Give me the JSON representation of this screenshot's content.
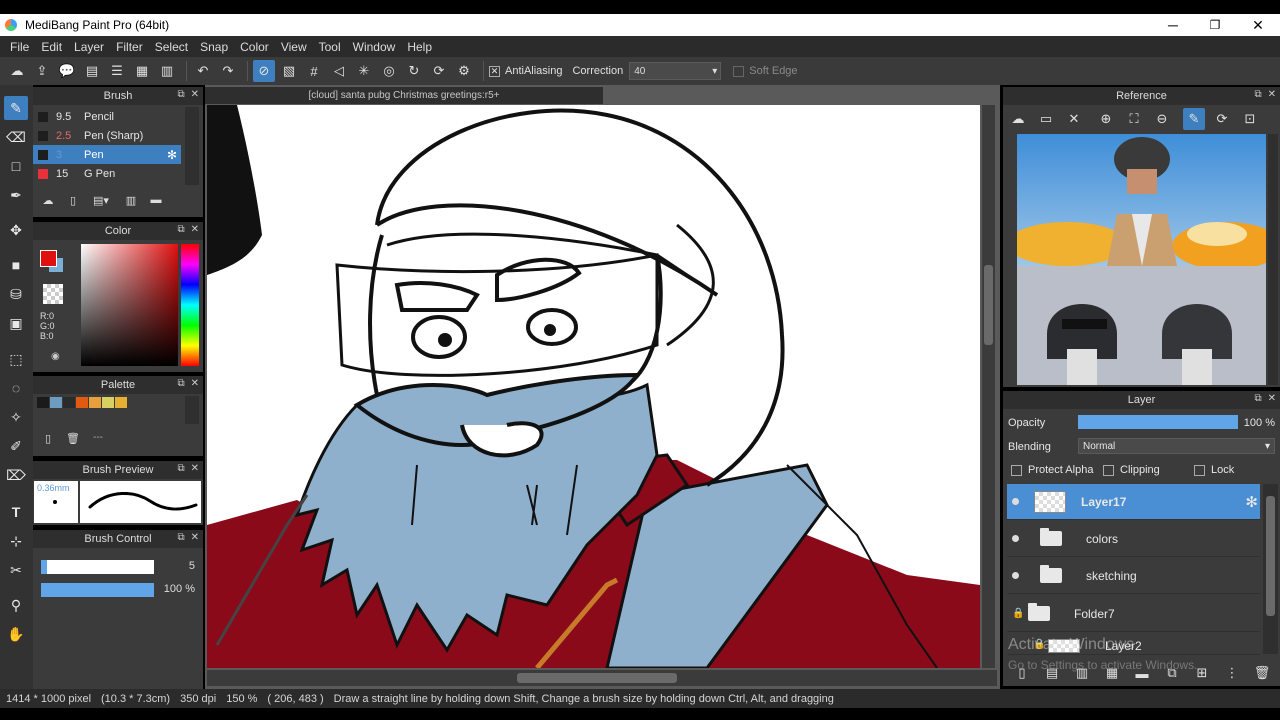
{
  "window": {
    "title": "MediBang Paint Pro (64bit)",
    "minimize": "─",
    "restore": "❐",
    "close": "✕"
  },
  "menu": [
    "File",
    "Edit",
    "Layer",
    "Filter",
    "Select",
    "Snap",
    "Color",
    "View",
    "Tool",
    "Window",
    "Help"
  ],
  "toolbar": {
    "antialiasing_label": "AntiAliasing",
    "antialiasing_checked": "✕",
    "correction_label": "Correction",
    "correction_value": "40",
    "soft_edge_label": "Soft Edge"
  },
  "document": {
    "tab_title": "[cloud] santa pubg Christmas greetings:r5+"
  },
  "brush_panel": {
    "title": "Brush",
    "items": [
      {
        "size": "9.5",
        "name": "Pencil",
        "color": "#1e1e1e"
      },
      {
        "size": "2.5",
        "name": "Pen (Sharp)",
        "color": "#1e1e1e"
      },
      {
        "size": "3",
        "name": "Pen",
        "color": "#1e1e1e"
      },
      {
        "size": "15",
        "name": "G Pen",
        "color": "#e8303a"
      }
    ]
  },
  "color_panel": {
    "title": "Color",
    "r": "R:0",
    "g": "G:0",
    "b": "B:0",
    "primary": "#e01010",
    "secondary": "#7ab0d8"
  },
  "palette_panel": {
    "title": "Palette",
    "swatches": [
      "#1a1a1a",
      "#6d9cc0",
      "#2b2b2b",
      "#e05a10",
      "#e8a03a",
      "#d8d060",
      "#e8b030"
    ],
    "dash": "---"
  },
  "brush_preview": {
    "title": "Brush Preview",
    "size_label": "0.36mm"
  },
  "brush_control": {
    "title": "Brush Control",
    "size_value": "5",
    "opacity_value": "100 %",
    "size_fraction": 0.05,
    "opacity_fraction": 1.0
  },
  "reference_panel": {
    "title": "Reference"
  },
  "layer_panel": {
    "title": "Layer",
    "opacity_label": "Opacity",
    "opacity_value": "100 %",
    "opacity_fraction": 1.0,
    "blending_label": "Blending",
    "blending_value": "Normal",
    "protect_alpha": "Protect Alpha",
    "clipping": "Clipping",
    "lock": "Lock",
    "layers": [
      {
        "name": "Layer17",
        "type": "layer",
        "selected": true
      },
      {
        "name": "colors",
        "type": "folder"
      },
      {
        "name": "sketching",
        "type": "folder"
      },
      {
        "name": "Folder7",
        "type": "folder",
        "locked": true
      },
      {
        "name": "Layer2",
        "type": "layer",
        "locked": true
      }
    ]
  },
  "watermark": {
    "line1": "Activate Windows",
    "line2": "Go to Settings to activate Windows."
  },
  "status": {
    "image_size": "1414 * 1000 pixel",
    "physical_size": "(10.3 * 7.3cm)",
    "dpi": "350 dpi",
    "zoom": "150 %",
    "cursor": "( 206, 483 )",
    "hint": "Draw a straight line by holding down Shift, Change a brush size by holding down Ctrl, Alt, and dragging"
  }
}
